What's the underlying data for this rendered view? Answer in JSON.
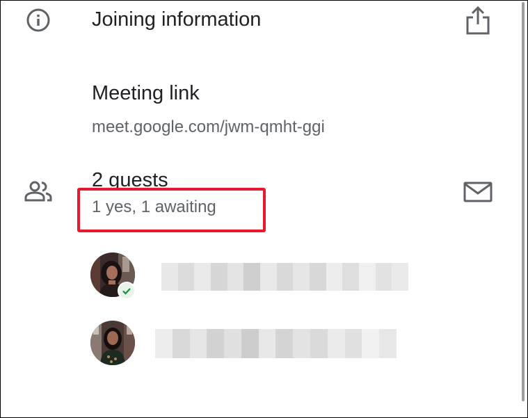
{
  "joining": {
    "info_icon": "info-icon",
    "title": "Joining information",
    "share_icon": "share-icon"
  },
  "meeting": {
    "label": "Meeting link",
    "url": "meet.google.com/jwm-qmht-ggi"
  },
  "guests": {
    "people_icon": "people-icon",
    "count_label": "2 guests",
    "status": "1 yes, 1 awaiting",
    "email_icon": "email-icon",
    "list": [
      {
        "avatar": "avatar",
        "rsvp": "accepted",
        "name_blurred": true
      },
      {
        "avatar": "avatar",
        "rsvp": "awaiting",
        "name_blurred": true
      }
    ]
  },
  "colors": {
    "highlight": "#e8192c",
    "primary_text": "#202124",
    "secondary_text": "#5f6368",
    "icon": "#5f6368"
  }
}
